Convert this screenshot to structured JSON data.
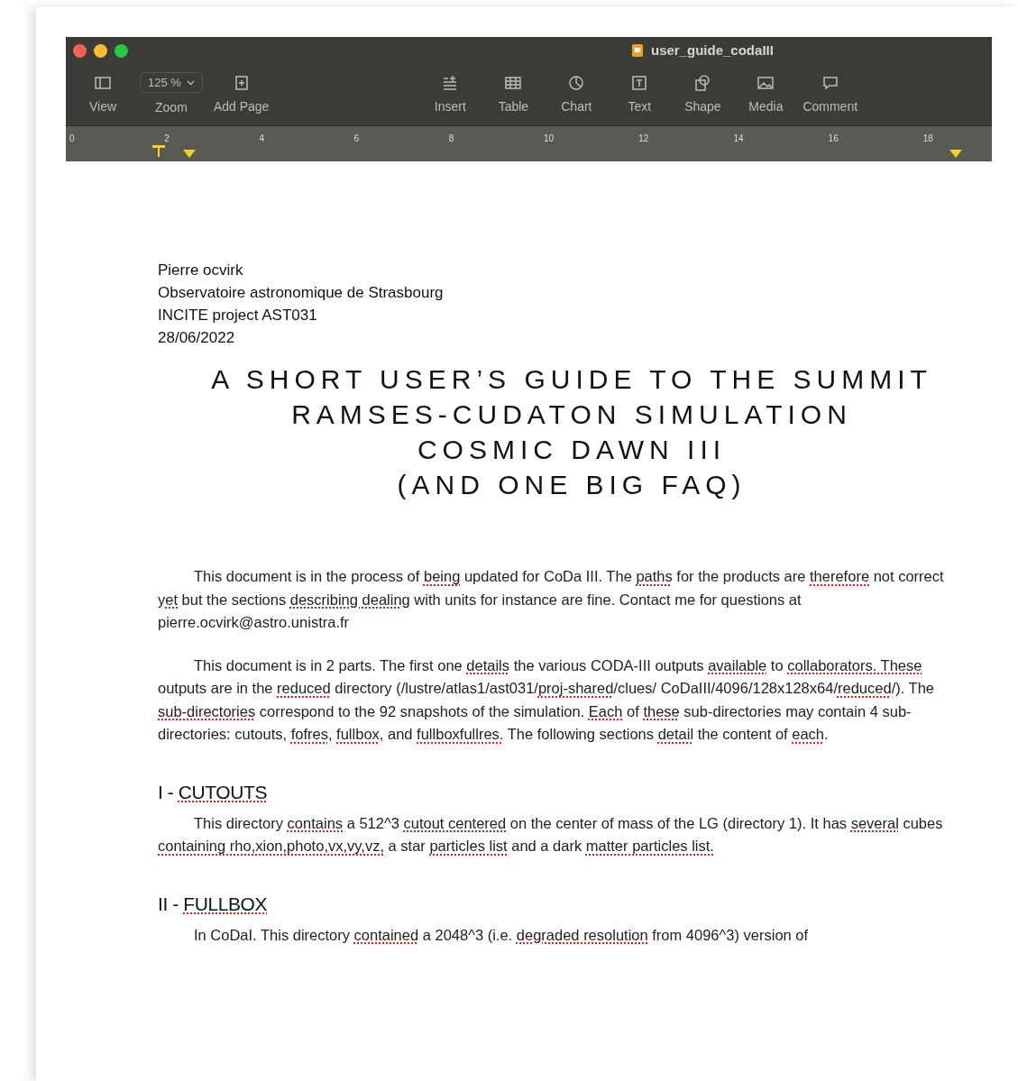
{
  "window": {
    "title": "user_guide_codaIII"
  },
  "toolbar": [
    {
      "label": "View",
      "kind": "button"
    },
    {
      "label": "Zoom",
      "kind": "dropdown",
      "value": "125 %"
    },
    {
      "label": "Add Page",
      "kind": "button"
    },
    {
      "label": "Insert",
      "kind": "button"
    },
    {
      "label": "Table",
      "kind": "button"
    },
    {
      "label": "Chart",
      "kind": "button"
    },
    {
      "label": "Text",
      "kind": "button"
    },
    {
      "label": "Shape",
      "kind": "button"
    },
    {
      "label": "Media",
      "kind": "button"
    },
    {
      "label": "Comment",
      "kind": "button"
    }
  ],
  "ruler": {
    "ticks": [
      "0",
      "2",
      "4",
      "6",
      "8",
      "10",
      "12",
      "14",
      "16",
      "18"
    ]
  },
  "document": {
    "header_lines": [
      "Pierre ocvirk",
      "Observatoire astronomique de Strasbourg",
      "INCITE project AST031",
      "28/06/2022"
    ],
    "title_lines": [
      "A SHORT USER’S GUIDE TO THE SUMMIT",
      "RAMSES-CUDATON SIMULATION",
      "COSMIC DAWN III",
      "(AND ONE BIG FAQ)"
    ],
    "blocks": [
      {
        "kind": "paragraph",
        "segments": [
          {
            "text": "This document is in the process of ",
            "flagged": false
          },
          {
            "text": "being",
            "flagged": true
          },
          {
            "text": " updated for CoDa III. The ",
            "flagged": false
          },
          {
            "text": "paths",
            "flagged": true
          },
          {
            "text": " for the products are ",
            "flagged": false
          },
          {
            "text": "therefore",
            "flagged": true
          },
          {
            "text": " not correct ",
            "flagged": false
          },
          {
            "text": "yet",
            "flagged": true
          },
          {
            "text": " but the sections ",
            "flagged": false
          },
          {
            "text": "describing dealing",
            "flagged": true
          },
          {
            "text": " with units for instance are fine. Contact me for questions at pierre.ocvirk@astro.unistra.fr",
            "flagged": false
          }
        ]
      },
      {
        "kind": "paragraph",
        "segments": [
          {
            "text": "This document is in 2 parts. The first one ",
            "flagged": false
          },
          {
            "text": "details",
            "flagged": true
          },
          {
            "text": " the various CODA-III outputs ",
            "flagged": false
          },
          {
            "text": "available",
            "flagged": true
          },
          {
            "text": " to ",
            "flagged": false
          },
          {
            "text": "collaborators. These",
            "flagged": true
          },
          {
            "text": " outputs are in the ",
            "flagged": false
          },
          {
            "text": "reduced",
            "flagged": true
          },
          {
            "text": " directory (/lustre/atlas1/ast031/",
            "flagged": false
          },
          {
            "text": "proj-shared",
            "flagged": true
          },
          {
            "text": "/clues/ CoDaIII/4096/128x128x64/",
            "flagged": false
          },
          {
            "text": "reduced",
            "flagged": true
          },
          {
            "text": "/). The ",
            "flagged": false
          },
          {
            "text": "sub-directories",
            "flagged": true
          },
          {
            "text": " correspond to the 92 snapshots of the simulation. ",
            "flagged": false
          },
          {
            "text": "Each",
            "flagged": true
          },
          {
            "text": " of ",
            "flagged": false
          },
          {
            "text": "these",
            "flagged": true
          },
          {
            "text": " sub-directories may contain 4 sub-directories: cutouts, ",
            "flagged": false
          },
          {
            "text": "fofres",
            "flagged": true
          },
          {
            "text": ", ",
            "flagged": false
          },
          {
            "text": "fullbox",
            "flagged": true
          },
          {
            "text": ", and ",
            "flagged": false
          },
          {
            "text": "fullboxfullres.",
            "flagged": true
          },
          {
            "text": " The following sections ",
            "flagged": false
          },
          {
            "text": "detail",
            "flagged": true
          },
          {
            "text": " the content of ",
            "flagged": false
          },
          {
            "text": "each",
            "flagged": true
          },
          {
            "text": ".",
            "flagged": false
          }
        ]
      },
      {
        "kind": "heading",
        "segments": [
          {
            "text": "I - ",
            "flagged": false
          },
          {
            "text": "CUTOUTS",
            "flagged": true
          }
        ]
      },
      {
        "kind": "paragraph",
        "segments": [
          {
            "text": "This directory ",
            "flagged": false
          },
          {
            "text": "contains",
            "flagged": true
          },
          {
            "text": " a 512^3 ",
            "flagged": false
          },
          {
            "text": "cutout centered",
            "flagged": true
          },
          {
            "text": " on the center of mass of the LG (directory 1). It has ",
            "flagged": false
          },
          {
            "text": "several",
            "flagged": true
          },
          {
            "text": " cubes ",
            "flagged": false
          },
          {
            "text": "containing rho,xion,photo,vx,vy,vz,",
            "flagged": true
          },
          {
            "text": " a star ",
            "flagged": false
          },
          {
            "text": "particles list",
            "flagged": true
          },
          {
            "text": " and a dark ",
            "flagged": false
          },
          {
            "text": "matter particles list.",
            "flagged": true
          }
        ]
      },
      {
        "kind": "heading",
        "segments": [
          {
            "text": "II - ",
            "flagged": false
          },
          {
            "text": "FULLBOX",
            "flagged": true
          }
        ]
      },
      {
        "kind": "paragraph",
        "segments": [
          {
            "text": "In CoDaI. This directory ",
            "flagged": false
          },
          {
            "text": "contained",
            "flagged": true
          },
          {
            "text": " a 2048^3 (i.e. ",
            "flagged": false
          },
          {
            "text": "degraded resolution",
            "flagged": true
          },
          {
            "text": " from 4096^3) version of",
            "flagged": false
          }
        ]
      }
    ]
  }
}
